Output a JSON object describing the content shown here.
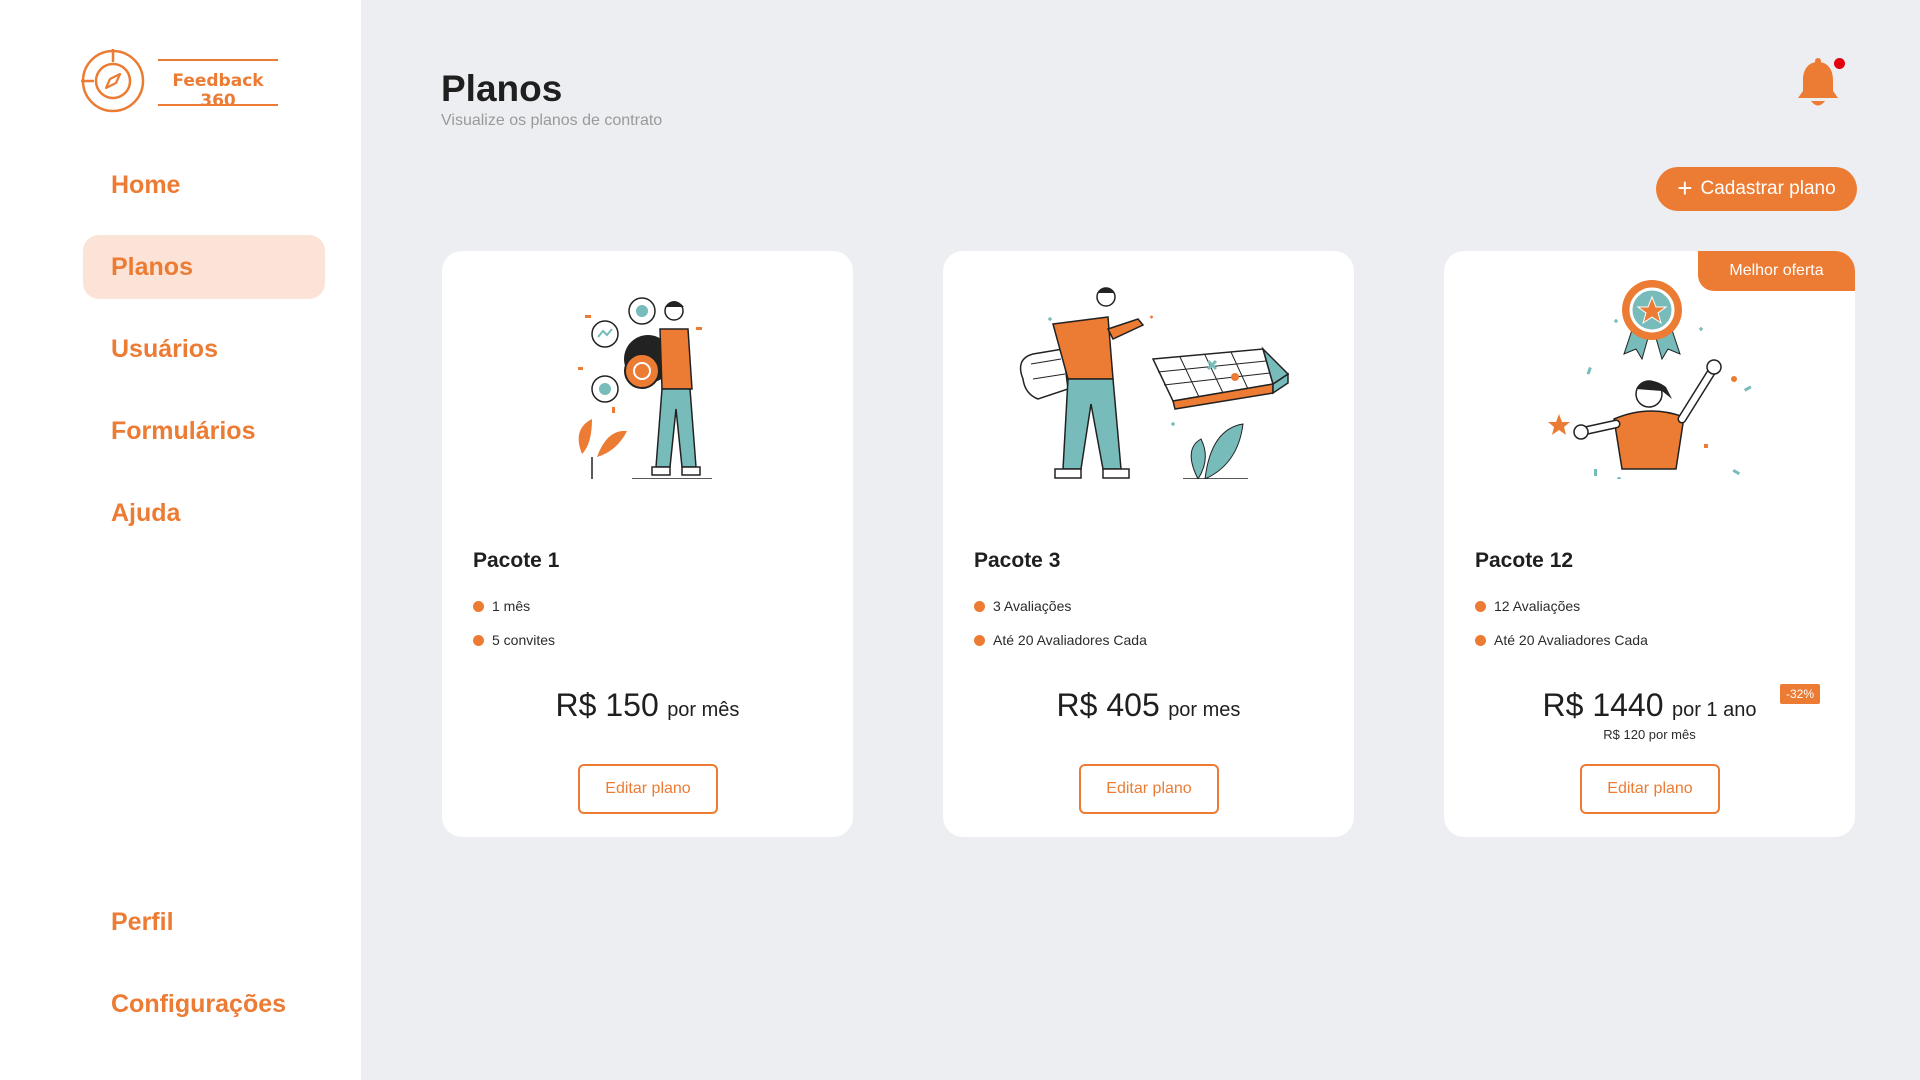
{
  "brand": {
    "name": "Feedback 360",
    "accent": "#ec7b33",
    "teal": "#78bbbb",
    "active_bg": "#fbe4d7",
    "notify": "#e3000f"
  },
  "sidebar": {
    "items": [
      {
        "label": "Home",
        "active": false
      },
      {
        "label": "Planos",
        "active": true
      },
      {
        "label": "Usuários",
        "active": false
      },
      {
        "label": "Formulários",
        "active": false
      },
      {
        "label": "Ajuda",
        "active": false
      }
    ],
    "bottom_items": [
      {
        "label": "Perfil"
      },
      {
        "label": "Configurações"
      }
    ]
  },
  "header": {
    "title": "Planos",
    "subtitle": "Visualize os planos de contrato",
    "notifications_icon": "bell-icon",
    "has_unread": true
  },
  "actions": {
    "add_plan_label": "Cadastrar plano",
    "add_plan_icon": "plus-icon"
  },
  "plans": [
    {
      "title": "Pacote 1",
      "features": [
        "1 mês",
        "5 convites"
      ],
      "price": "R$ 150",
      "period": "por mês",
      "sub_price": "",
      "discount": "",
      "badge": "",
      "edit_label": "Editar plano",
      "illustration": "person-with-target-illustration"
    },
    {
      "title": "Pacote 3",
      "features": [
        "3 Avaliações",
        "Até 20 Avaliadores Cada"
      ],
      "price": "R$ 405",
      "period": "por mes",
      "sub_price": "",
      "discount": "",
      "badge": "",
      "edit_label": "Editar plano",
      "illustration": "person-with-chess-board-illustration"
    },
    {
      "title": "Pacote 12",
      "features": [
        "12 Avaliações",
        "Até 20 Avaliadores Cada"
      ],
      "price": "R$ 1440",
      "period": "por 1 ano",
      "sub_price": "R$ 120 por mês",
      "discount": "-32%",
      "badge": "Melhor oferta",
      "edit_label": "Editar plano",
      "illustration": "woman-with-medal-illustration"
    }
  ]
}
